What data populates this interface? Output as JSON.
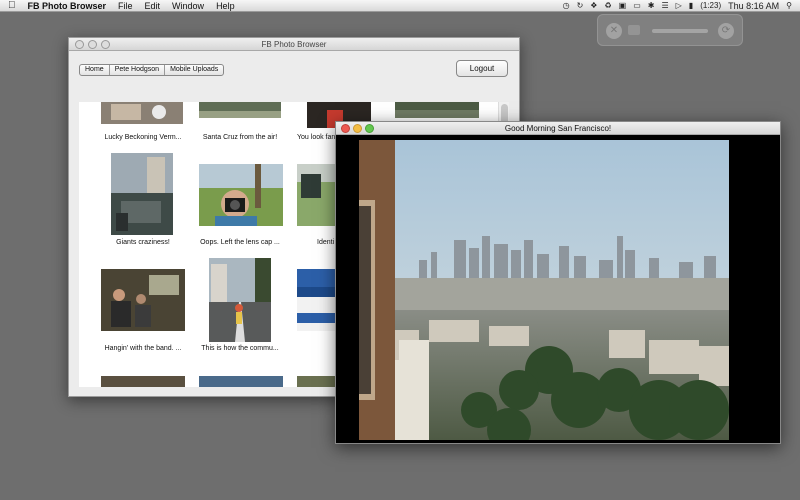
{
  "menubar": {
    "app_name": "FB Photo Browser",
    "menus": [
      "File",
      "Edit",
      "Window",
      "Help"
    ],
    "battery": "(1:23)",
    "clock": "Thu 8:16 AM"
  },
  "browser": {
    "title": "FB Photo Browser",
    "breadcrumb": [
      "Home",
      "Pete Hodgson",
      "Mobile Uploads"
    ],
    "logout_label": "Logout",
    "captions": {
      "r1c1": "Lucky Beckoning Verm...",
      "r1c2": "Santa Cruz from the air!",
      "r1c3": "You look fan",
      "r2c1": "Giants craziness!",
      "r2c2": "Oops. Left the lens cap ...",
      "r2c3": "Identi",
      "r3c1": "Hangin' with the band. ...",
      "r3c2": "This is how the commu..."
    }
  },
  "photo_window": {
    "title": "Good Morning San Francisco!"
  },
  "colors": {
    "desktop": "#6e6e6e",
    "window_chrome": "#ececec",
    "close_red": "#ee5a52",
    "minimize_yellow": "#f4bd43",
    "zoom_green": "#63c74f"
  }
}
